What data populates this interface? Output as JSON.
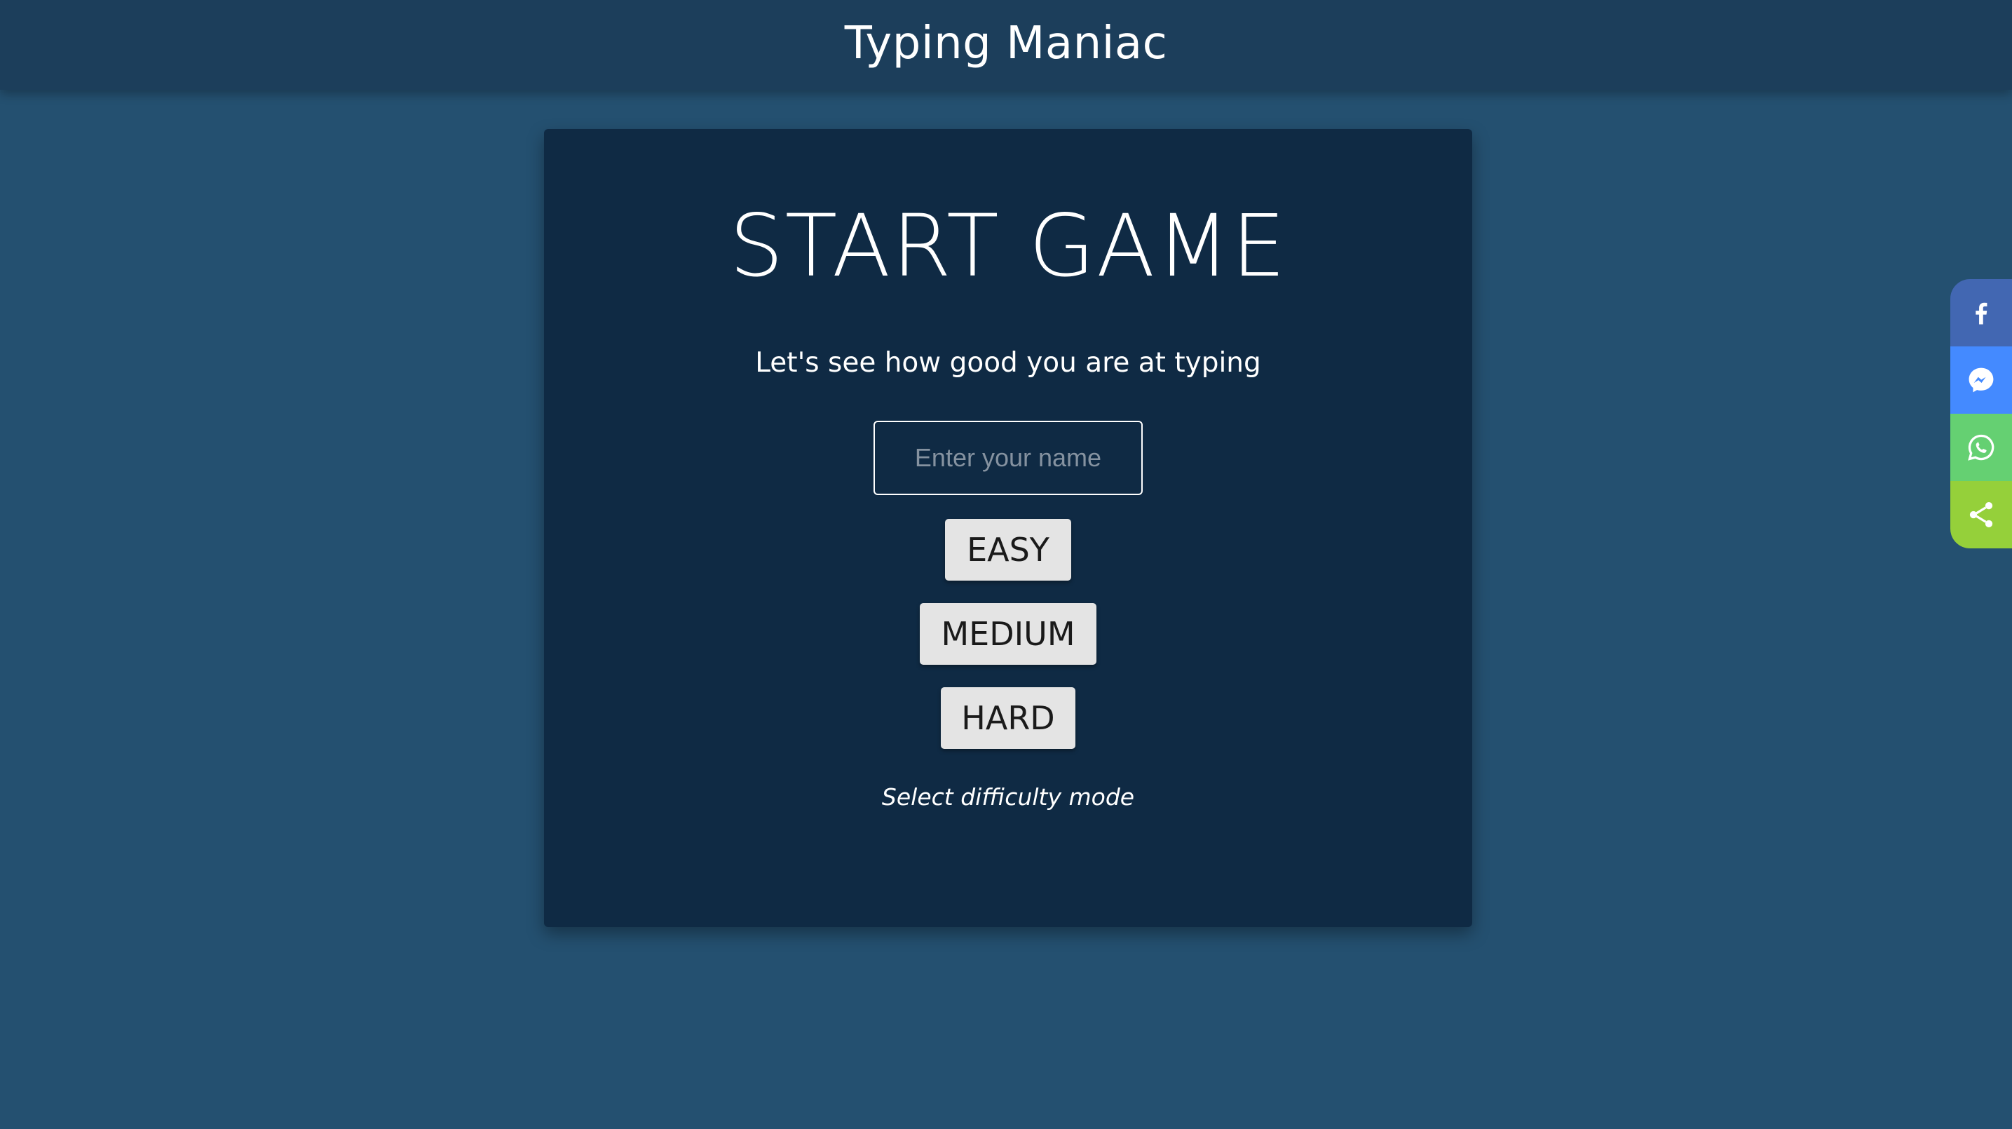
{
  "header": {
    "title": "Typing Maniac"
  },
  "start_card": {
    "title": "START GAME",
    "subtitle": "Let's see how good you are at typing",
    "name_input": {
      "placeholder": "Enter your name",
      "value": ""
    },
    "difficulty_buttons": [
      {
        "label": "EASY"
      },
      {
        "label": "MEDIUM"
      },
      {
        "label": "HARD"
      }
    ],
    "hint": "Select difficulty mode"
  },
  "share_bar": {
    "items": [
      {
        "icon": "facebook-icon",
        "color": "#4267b2"
      },
      {
        "icon": "messenger-icon",
        "color": "#448aff"
      },
      {
        "icon": "whatsapp-icon",
        "color": "#65d072"
      },
      {
        "icon": "share-icon",
        "color": "#95d03a"
      }
    ]
  },
  "colors": {
    "page_background": "#245070",
    "header_background": "#1c3e5b",
    "card_background": "#0f2a44",
    "button_background": "#e4e4e4"
  }
}
